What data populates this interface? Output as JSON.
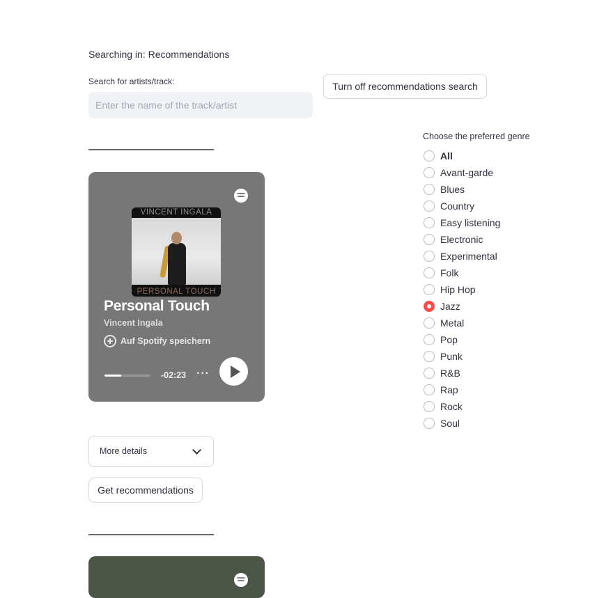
{
  "search": {
    "status_text": "Searching in: Recommendations",
    "label": "Search for artists/track:",
    "placeholder": "Enter the name of the track/artist",
    "value": "",
    "toggle_button_label": "Turn off recommendations search"
  },
  "player": {
    "cover_top_text": "VINCENT INGALA",
    "cover_bottom_text": "PERSONAL TOUCH",
    "title": "Personal Touch",
    "artist": "Vincent Ingala",
    "save_label": "Auf Spotify speichern",
    "time_remaining": "-02:23",
    "more_label": "···",
    "progress_fraction": 0.36
  },
  "details": {
    "expander_label": "More details",
    "recommend_button_label": "Get recommendations"
  },
  "genre": {
    "label": "Choose the preferred genre",
    "options": [
      "All",
      "Avant-garde",
      "Blues",
      "Country",
      "Easy listening",
      "Electronic",
      "Experimental",
      "Folk",
      "Hip Hop",
      "Jazz",
      "Metal",
      "Pop",
      "Punk",
      "R&B",
      "Rap",
      "Rock",
      "Soul"
    ],
    "selected": "Jazz"
  },
  "colors": {
    "accent": "#ff4b4b",
    "card_bg": "#777777",
    "card2_bg": "#4a5546",
    "input_bg": "#f0f2f6"
  }
}
